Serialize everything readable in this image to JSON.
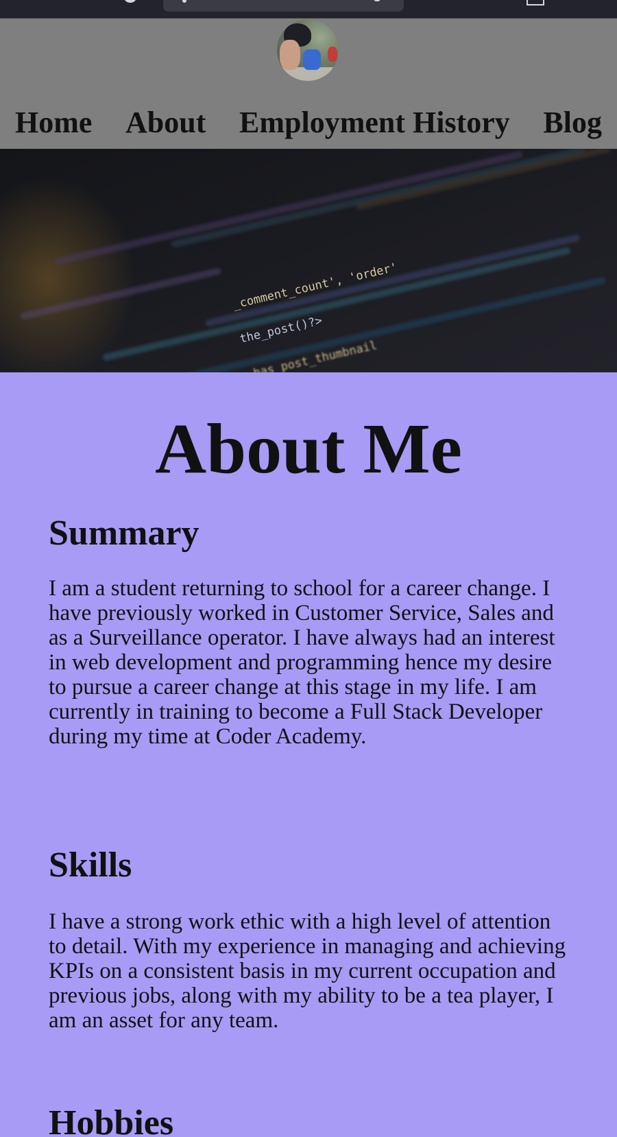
{
  "nav": {
    "items": [
      {
        "label": "Home"
      },
      {
        "label": "About"
      },
      {
        "label": "Employment History"
      },
      {
        "label": "Blog"
      }
    ]
  },
  "hero": {
    "code_1": "_comment_count', 'order'",
    "code_2": "the_post()?>",
    "code_3": "has_post_thumbnail"
  },
  "main": {
    "title": "About Me",
    "sections": [
      {
        "heading": "Summary",
        "text": "I am a student returning to school for a career change. I have previously worked in Customer Service, Sales and as a Surveillance operator. I have always had an interest in web development and programming hence my desire to pursue a career change at this stage in my life. I am currently in training to become a Full Stack Developer during my time at Coder Academy."
      },
      {
        "heading": "Skills",
        "text": "I have a strong work ethic with a high level of attention to detail. With my experience in managing and achieving KPIs on a consistent basis in my current occupation and previous jobs, along with my ability to be a tea player, I am an asset for any team."
      },
      {
        "heading": "Hobbies"
      }
    ]
  },
  "colors": {
    "header_bg": "#7f7f7f",
    "content_bg": "#a89bf6",
    "browser_bar_bg": "#23232b"
  }
}
